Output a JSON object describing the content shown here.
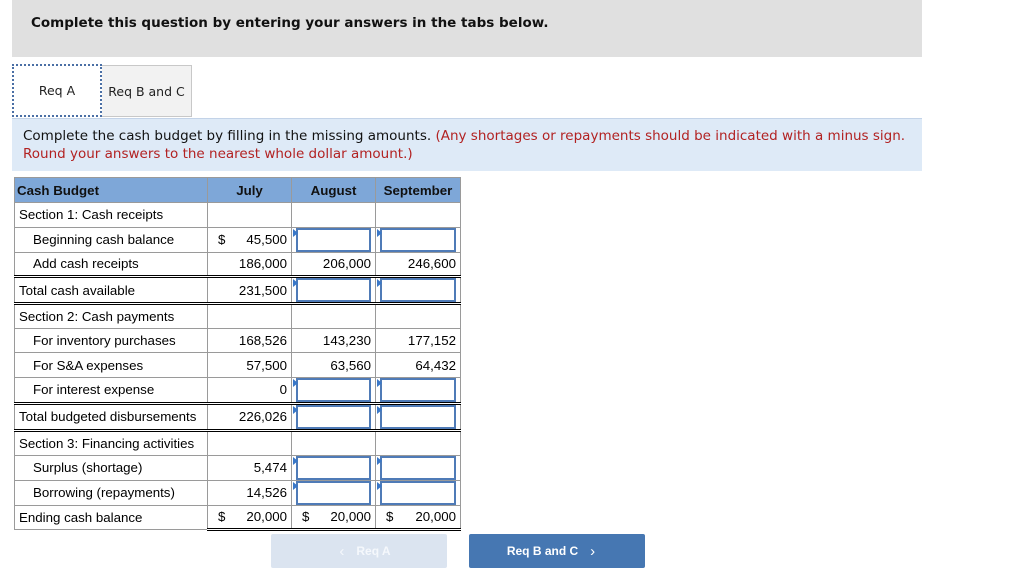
{
  "instruction": "Complete this question by entering your answers in the tabs below.",
  "tabs": [
    {
      "label": "Req A",
      "active": true
    },
    {
      "label": "Req B and C",
      "active": false
    }
  ],
  "prompt": {
    "text": "Complete the cash budget by filling in the missing amounts.",
    "note": "(Any shortages or repayments should be indicated with a minus sign. Round your answers to the nearest whole dollar amount.)"
  },
  "table": {
    "headers": [
      "Cash Budget",
      "July",
      "August",
      "September"
    ],
    "rows": {
      "section1": {
        "label": "Section 1: Cash receipts"
      },
      "beginning": {
        "label": "Beginning cash balance",
        "july": "45,500",
        "july_dollar": "$",
        "august": "",
        "september": ""
      },
      "receipts": {
        "label": "Add cash receipts",
        "july": "186,000",
        "august": "206,000",
        "september": "246,600"
      },
      "total_available": {
        "label": "Total cash available",
        "july": "231,500",
        "august": "",
        "september": ""
      },
      "section2": {
        "label": "Section 2: Cash payments"
      },
      "inventory": {
        "label": "For inventory purchases",
        "july": "168,526",
        "august": "143,230",
        "september": "177,152"
      },
      "sa": {
        "label": "For S&A expenses",
        "july": "57,500",
        "august": "63,560",
        "september": "64,432"
      },
      "interest": {
        "label": "For interest expense",
        "july": "0",
        "august": "",
        "september": ""
      },
      "total_disb": {
        "label": "Total budgeted disbursements",
        "july": "226,026",
        "august": "",
        "september": ""
      },
      "section3": {
        "label": "Section 3: Financing activities"
      },
      "surplus": {
        "label": "Surplus (shortage)",
        "july": "5,474",
        "august": "",
        "september": ""
      },
      "borrowing": {
        "label": "Borrowing (repayments)",
        "july": "14,526",
        "august": "",
        "september": ""
      },
      "ending": {
        "label": "Ending cash balance",
        "dollar": "$",
        "july": "20,000",
        "august": "20,000",
        "september": "20,000"
      }
    }
  },
  "nav": {
    "prev_label": "Req A",
    "next_label": "Req B and C",
    "prev_icon": "‹",
    "next_icon": "›"
  }
}
